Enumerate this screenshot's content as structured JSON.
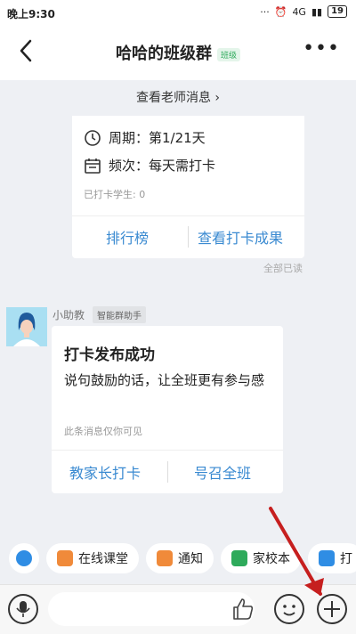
{
  "status_bar": {
    "time": "晚上9:30",
    "signal": "4G",
    "battery": "19"
  },
  "header": {
    "title": "哈哈的班级群",
    "tag": "班级",
    "more_label": "•••"
  },
  "teacher_link": {
    "label": "查看老师消息",
    "chevron": "›"
  },
  "checkin_card": {
    "period_label": "周期：第1/21天",
    "frequency_label": "频次：每天需打卡",
    "students_count": "已打卡学生: 0",
    "ranking_button": "排行榜",
    "results_button": "查看打卡成果"
  },
  "read_status": "全部已读",
  "message": {
    "sender_name": "小助教",
    "sender_tag": "智能群助手",
    "title": "打卡发布成功",
    "body": "说句鼓励的话，让全班更有参与感",
    "note": "此条消息仅你可见",
    "parents_button": "教家长打卡",
    "summon_button": "号召全班"
  },
  "quick_actions": [
    {
      "label": "",
      "icon": "robot-icon",
      "color": "#2f8de4"
    },
    {
      "label": "在线课堂",
      "icon": "classroom-icon",
      "color": "#f08a3a"
    },
    {
      "label": "通知",
      "icon": "megaphone-icon",
      "color": "#f08a3a"
    },
    {
      "label": "家校本",
      "icon": "notebook-icon",
      "color": "#2eaa5b"
    },
    {
      "label": "打",
      "icon": "checklist-icon",
      "color": "#2f8de4"
    }
  ],
  "input": {
    "placeholder": ""
  }
}
